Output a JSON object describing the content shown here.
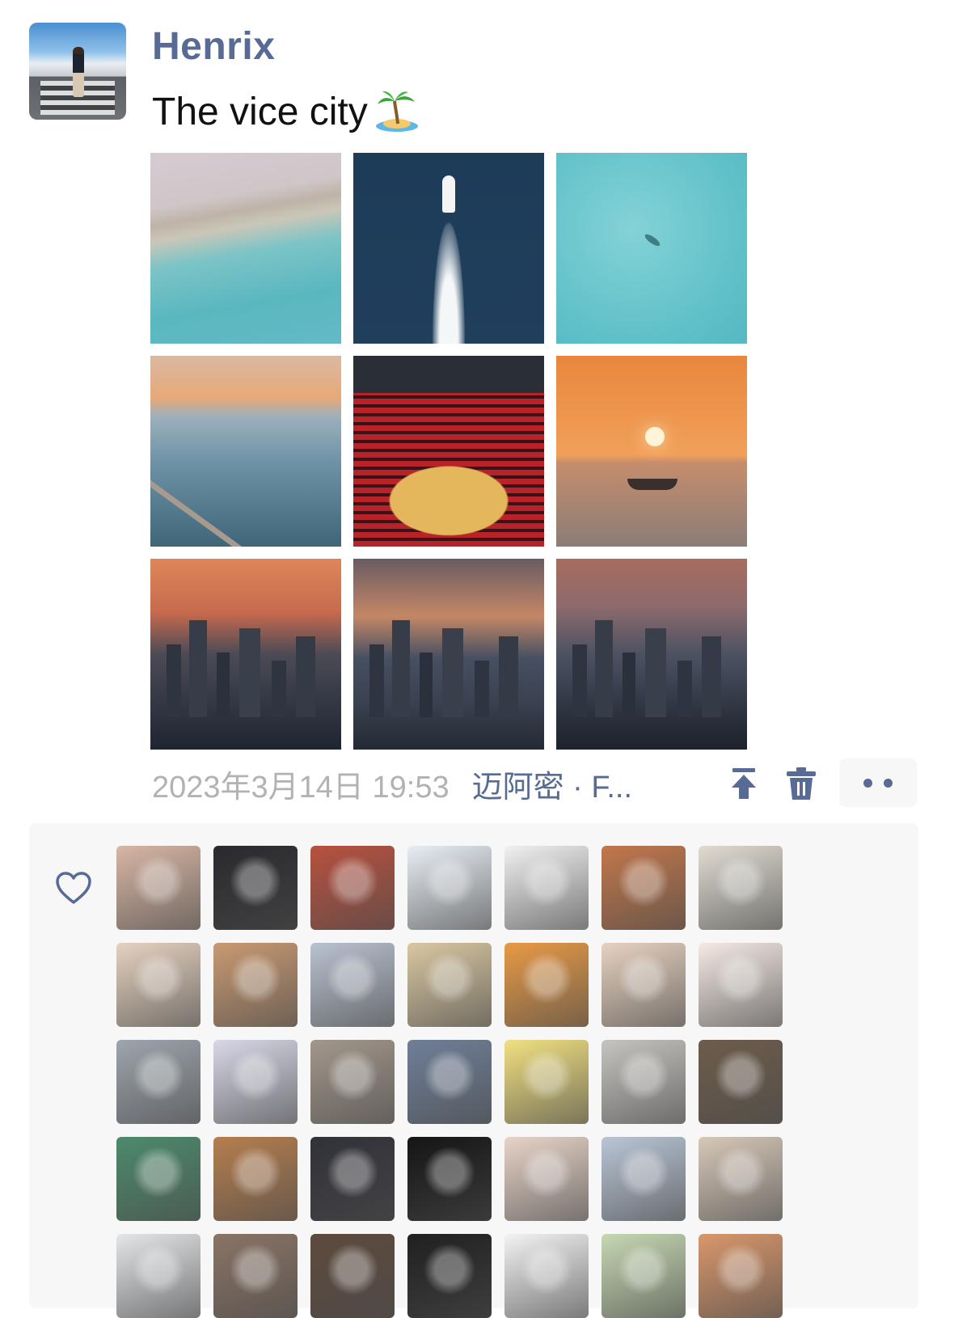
{
  "post": {
    "author_name": "Henrix",
    "caption_text": "The vice city",
    "caption_emoji": "desert-island-emoji",
    "photos_count": 9
  },
  "meta": {
    "timestamp": "2023年3月14日 19:53",
    "location": "迈阿密 · F..."
  },
  "actions": {
    "pin_icon": "pin-to-top-icon",
    "delete_icon": "trash-icon",
    "more_icon": "more-dots-icon"
  },
  "likes": {
    "icon": "heart-outline-icon",
    "avatar_colors": [
      [
        "#d8b6a4",
        "#2a2a2e",
        "#b8513f",
        "#e8eef4",
        "#f1f1f1",
        "#c2774b",
        "#e1dcd2"
      ],
      [
        "#e6d2c0",
        "#c99a72",
        "#b9c2d0",
        "#d9c7a1",
        "#e89a45",
        "#e7d2c0",
        "#f5eae3"
      ],
      [
        "#9ea5ad",
        "#d8d8e8",
        "#a3978b",
        "#6f7f98",
        "#f1e081",
        "#c6c4c0",
        "#6d5c4b"
      ],
      [
        "#4d8a6b",
        "#b67e4e",
        "#313139",
        "#151515",
        "#e8d4c8",
        "#b9c6d6",
        "#d7c8b8"
      ],
      [
        "#e4e6e8",
        "#8a7465",
        "#5e4a3d",
        "#202020",
        "#f3f3f3",
        "#c6d8b2",
        "#d9976b"
      ]
    ]
  },
  "colors": {
    "link_blue": "#576b95",
    "timestamp_gray": "#b2b2b2",
    "panel_bg": "#f7f7f7"
  }
}
